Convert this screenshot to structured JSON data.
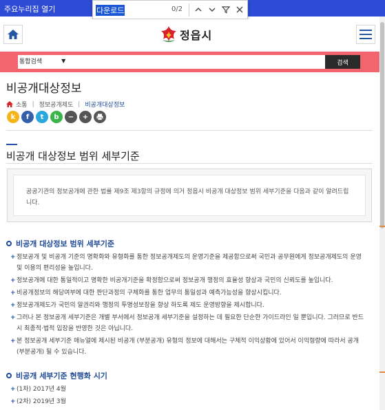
{
  "topbar": {
    "skip_link": "주요누리집 열기"
  },
  "findbar": {
    "query": "다운로드",
    "count": "0/2"
  },
  "header": {
    "site_name": "정읍시"
  },
  "search": {
    "scope": "통합검색",
    "button": "검색"
  },
  "page": {
    "title": "비공개대상정보",
    "breadcrumb": [
      "소통",
      "정보공개제도",
      "비공개대상정보"
    ]
  },
  "shares": [
    {
      "label": "k",
      "icon": "kakaostory-icon",
      "color": "#f4b41a"
    },
    {
      "label": "f",
      "icon": "facebook-icon",
      "color": "#3460a9"
    },
    {
      "label": "t",
      "icon": "twitter-icon",
      "color": "#2aa7df"
    },
    {
      "label": "b",
      "icon": "band-icon",
      "color": "#39b54a"
    },
    {
      "label": "−",
      "icon": "zoom-out-icon",
      "color": "#555555"
    },
    {
      "label": "+",
      "icon": "zoom-in-icon",
      "color": "#555555"
    },
    {
      "label": "",
      "icon": "print-icon",
      "color": "#555555"
    }
  ],
  "section": {
    "title": "비공개 대상정보 범위 세부기준",
    "intro": "공공기관의 정보공개에 관한 법률 제9조 제3항의 규정에 의거 정읍시 비공개 대상정보 범위 세부기준을 다음과 같이 알려드립니다."
  },
  "criteria": {
    "heading": "비공개 대상정보 범위 세부기준",
    "items": [
      "정보공개 및 비공개 기준의 명확화와 유형화를 통한 정보공개제도의 운영기준을 제공함으로써 국민과 공무원에게 정보공개제도의 운영 및 이용의 편리성을 높입니다.",
      "정보공개에 대한 통일적이고 명확한 비공개기준을 확정함으로써 정보공개 행정의 효율성 향상과 국민의 신뢰도를 높입니다.",
      "비공개정보의 해당여부에 대한 판단과정의 구체화를 통한 업무의 통일성과 예측가능성을 향상시킵니다.",
      "정보공개제도가 국민의 알권리와 행정의 투명성보장을 향상 하도록 제도 운영방향을 제시합니다.",
      "그러나 본 정보공개 세부기준은 개별 부서에서 정보공개 세부기준을 설정하는 데 필요한 단순한 가이드라인 일 뿐입니다. 그러므로 반드시 최종적·법적 입장을 반영한 것은 아닙니다.",
      "본 정보공개 세부기준 매뉴얼에 제시된 비공개 (부분공개) 유형의 정보에 대해서는 구체적 이익상황에 있어서 이익형량에 따라서 공개 (부분공개) 될 수 있습니다."
    ]
  },
  "timeline": {
    "heading": "비공개 세부기준 현행화 시기",
    "items": [
      "(1차) 2017년 4월",
      "(2차) 2019년 3월"
    ]
  }
}
